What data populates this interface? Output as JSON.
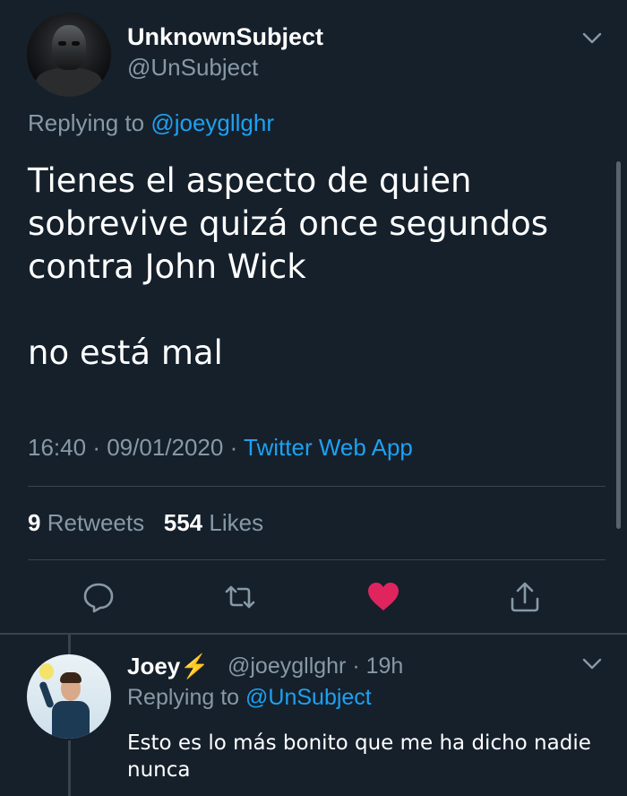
{
  "tweet": {
    "display_name": "UnknownSubject",
    "handle": "@UnSubject",
    "replying_prefix": "Replying to",
    "replying_to": "@joeygllghr",
    "text_lines": [
      "Tienes el aspecto de quien",
      "sobrevive quizá once segundos",
      "contra John Wick"
    ],
    "text_tail": "no está mal",
    "time": "16:40",
    "date": "09/01/2020",
    "separator": "·",
    "source": "Twitter Web App",
    "retweets_count": "9",
    "retweets_label": "Retweets",
    "likes_count": "554",
    "likes_label": "Likes",
    "liked": true
  },
  "actions": [
    "reply-icon",
    "retweet-icon",
    "like-icon",
    "share-icon"
  ],
  "reply": {
    "display_name": "Joey",
    "emoji": "⚡",
    "handle": "@joeygllghr",
    "separator": "·",
    "age": "19h",
    "replying_prefix": "Replying to",
    "replying_to": "@UnSubject",
    "text": "Esto es lo más bonito que me ha dicho nadie nunca"
  },
  "colors": {
    "background": "#15202b",
    "text": "#ffffff",
    "secondary": "#8899a6",
    "link": "#1da1f2",
    "like": "#e0245e",
    "divider": "#38444d"
  }
}
